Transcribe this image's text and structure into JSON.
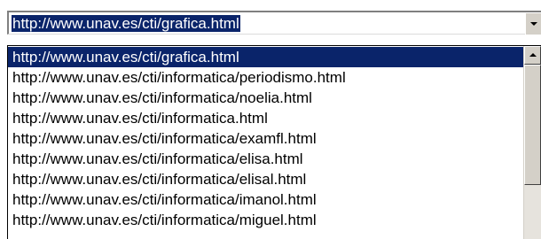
{
  "address_combo": {
    "value": "http://www.unav.es/cti/grafica.html",
    "arrow_icon": "chevron-down-icon"
  },
  "dropdown": {
    "items": [
      "http://www.unav.es/cti/grafica.html",
      "http://www.unav.es/cti/informatica/periodismo.html",
      "http://www.unav.es/cti/informatica/noelia.html",
      "http://www.unav.es/cti/informatica.html",
      "http://www.unav.es/cti/informatica/examfl.html",
      "http://www.unav.es/cti/informatica/elisa.html",
      "http://www.unav.es/cti/informatica/elisal.html",
      "http://www.unav.es/cti/informatica/imanol.html",
      "http://www.unav.es/cti/informatica/miguel.html"
    ],
    "selected_index": 0,
    "scroll_up_icon": "chevron-up-icon"
  },
  "colors": {
    "selection": "#0a246a",
    "chrome": "#d4d0c8"
  }
}
